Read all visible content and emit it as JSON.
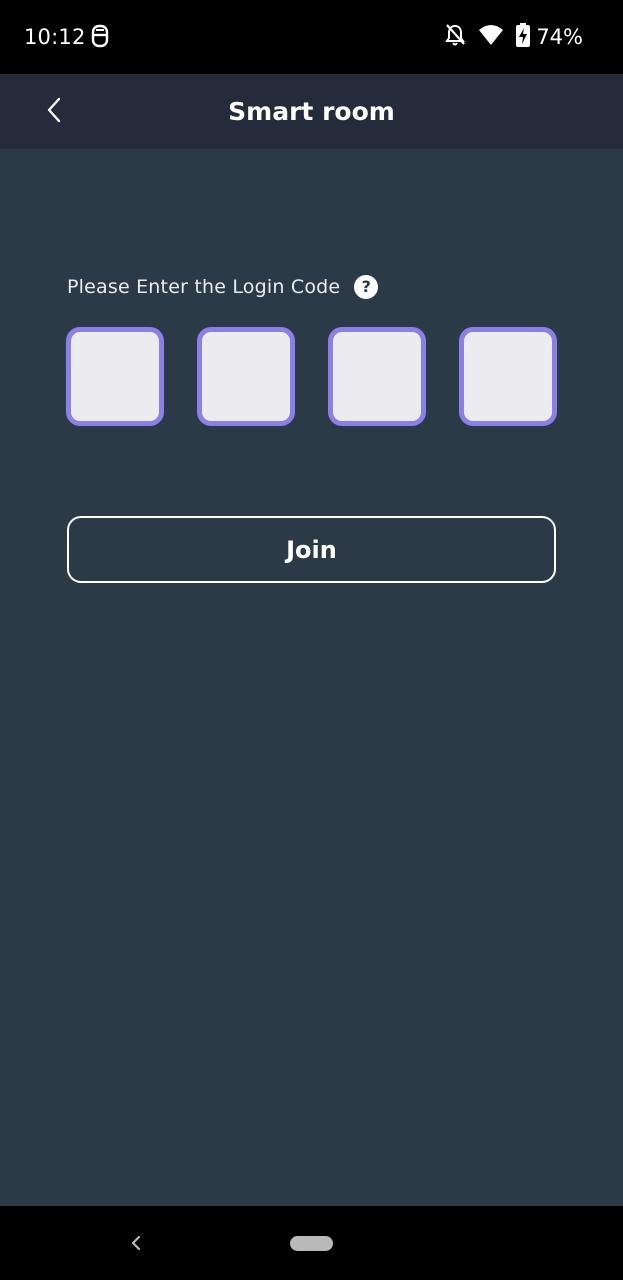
{
  "status_bar": {
    "time": "10:12",
    "battery_percent": "74%",
    "icons": [
      "notification-app-icon",
      "bell-off-icon",
      "wifi-icon",
      "battery-charging-icon"
    ]
  },
  "app_bar": {
    "title": "Smart room",
    "back_icon": "chevron-left-icon"
  },
  "login": {
    "prompt": "Please Enter the Login Code",
    "help_icon_glyph": "?",
    "code_digits": [
      "",
      "",
      "",
      ""
    ],
    "join_label": "Join"
  },
  "nav_bar": {
    "back_icon": "nav-back-icon",
    "home_icon": "nav-home-pill"
  },
  "colors": {
    "background": "#2c3a48",
    "app_bar": "#242c3b",
    "accent": "#8b7fe8",
    "code_box_fill": "#ebebf0",
    "text": "#ffffff"
  }
}
